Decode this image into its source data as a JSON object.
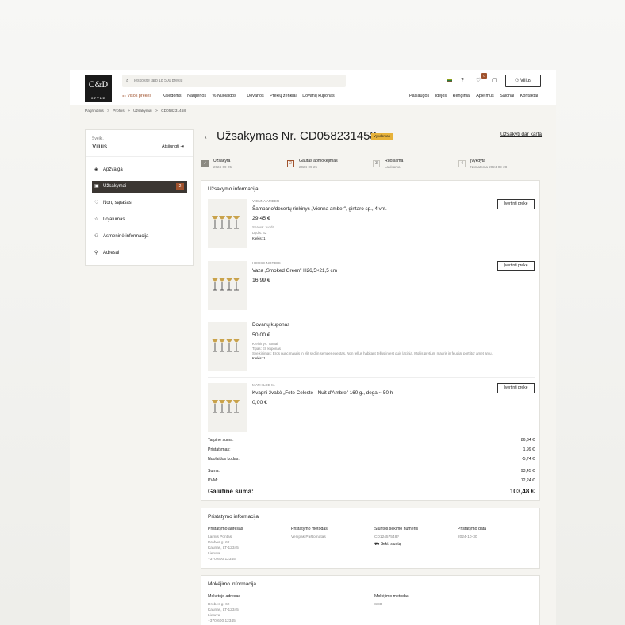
{
  "header": {
    "logo_text": "C&D",
    "logo_sub": "STYLE",
    "search_placeholder": "Ieškokite tarp 18 500 prekių",
    "cart_count": "0",
    "user_label": "Vilius",
    "nav_left": [
      "Visos prekės",
      "Kalėdoms",
      "Naujienos",
      "Nuolaidos",
      "Dovanos",
      "Prekių ženklai",
      "Dovanų kuponas"
    ],
    "nav_right": [
      "Paslaugos",
      "Idėjos",
      "Renginiai",
      "Apie mus",
      "Salonai",
      "Kontaktai"
    ]
  },
  "breadcrumb": [
    "Pagrindinis",
    ">",
    "Profilis",
    ">",
    "Užsakymai",
    ">",
    "CD058231458"
  ],
  "sidebar": {
    "greeting": "Sveiki,",
    "name": "Vilius",
    "logout": "Atsijungti",
    "items": [
      {
        "label": "Apžvalga",
        "icon": "shield-check-icon",
        "glyph": "◈"
      },
      {
        "label": "Užsakymai",
        "icon": "box-icon",
        "glyph": "▣",
        "count": "2"
      },
      {
        "label": "Norų sąrašas",
        "icon": "heart-icon",
        "glyph": "♡"
      },
      {
        "label": "Lojalumas",
        "icon": "star-icon",
        "glyph": "☆"
      },
      {
        "label": "Asmeninė informacija",
        "icon": "user-icon",
        "glyph": "⚇"
      },
      {
        "label": "Adresai",
        "icon": "pin-icon",
        "glyph": "⚲"
      }
    ]
  },
  "order": {
    "title": "Užsakymas Nr. CD058231458",
    "status": "Vykdomas",
    "reorder": "Užsakyti dar kartą",
    "steps": [
      {
        "num": "✓",
        "label": "Užsakyta",
        "date": "2024-09-25"
      },
      {
        "num": "2",
        "label": "Gautas apmokėjimas",
        "date": "2024-09-25"
      },
      {
        "num": "3",
        "label": "Ruošiama",
        "date": "Laukiama"
      },
      {
        "num": "4",
        "label": "Įvykdyta",
        "date": "Numatoma 2024-09-28"
      }
    ]
  },
  "order_info": {
    "heading": "Užsakymo informacija",
    "rate_label": "Įvertinti prekę",
    "products": [
      {
        "brand": "VIENNA AMBER",
        "name": "Šampano/desertų rinkinys „Vienna amber\", gintaro sp., 4 vnt.",
        "price": "29,45 €",
        "meta": [
          "Spalva: Juoda",
          "Dydis: 42"
        ],
        "qty": "Kiekis: 1"
      },
      {
        "brand": "HOUSE NORDIC",
        "name": "Vaza „Smoked Green\" H26,5×21,5 cm",
        "price": "16,99 €",
        "meta": [],
        "qty": ""
      },
      {
        "brand": "",
        "name": "Dovanų kuponas",
        "price": "50,00 €",
        "meta": [
          "Kreipinys: Tomai",
          "Tipas: El. kuponas",
          "Sveikinimas: Eros nunc mauris in elit sed in semper egestas. Non tellus habitant tellus in est quis lacinia. Mollis pretium mauris in feugiat porttitor amet arcu."
        ],
        "qty": "Kiekis: 1"
      },
      {
        "brand": "MATHILDE M.",
        "name": "Kvapni žvakė „Fete Celeste - Nuit d'Ambre\" 160 g., dega ~ 50 h",
        "price": "0,00 €",
        "meta": [],
        "qty": ""
      }
    ],
    "totals": [
      {
        "label": "Tarpinė suma:",
        "value": "86,34 €"
      },
      {
        "label": "Pristatymas:",
        "value": "1,99 €"
      },
      {
        "label": "Nuolaidos kodas:",
        "value": "-5,74 €"
      },
      {
        "label": "Suma:",
        "value": "93,45 €"
      },
      {
        "label": "PVM:",
        "value": "12,24 €"
      }
    ],
    "grand_label": "Galutinė suma:",
    "grand_value": "103,48 €"
  },
  "delivery": {
    "heading": "Pristatymo informacija",
    "address_label": "Pristatymo adresas",
    "address_lines": [
      "Laimis Pontas",
      "Drobės g. 62",
      "Kaunas, LT-12345",
      "Lietuva",
      "+370 600 12345"
    ],
    "method_label": "Pristatymo metodas",
    "method_value": "Venipak Paštomatas",
    "tracking_label": "Siuntos sekimo numeris",
    "tracking_value": "CD12457548?",
    "tracking_link": "Sekti siuntą",
    "date_label": "Pristatymo data",
    "date_value": "2024-10-30"
  },
  "payment": {
    "heading": "Mokėjimo informacija",
    "payer_label": "Mokėtojo adresas",
    "payer_lines": [
      "Drobės g. 62",
      "Kaunas, LT-12345",
      "Lietuva",
      "+370 600 12345"
    ],
    "method_label": "Mokėjimo metodas",
    "method_value": "SEB"
  },
  "colors": {
    "accent": "#a0522d",
    "status": "#e7b23a",
    "active_nav": "#3b3632"
  }
}
